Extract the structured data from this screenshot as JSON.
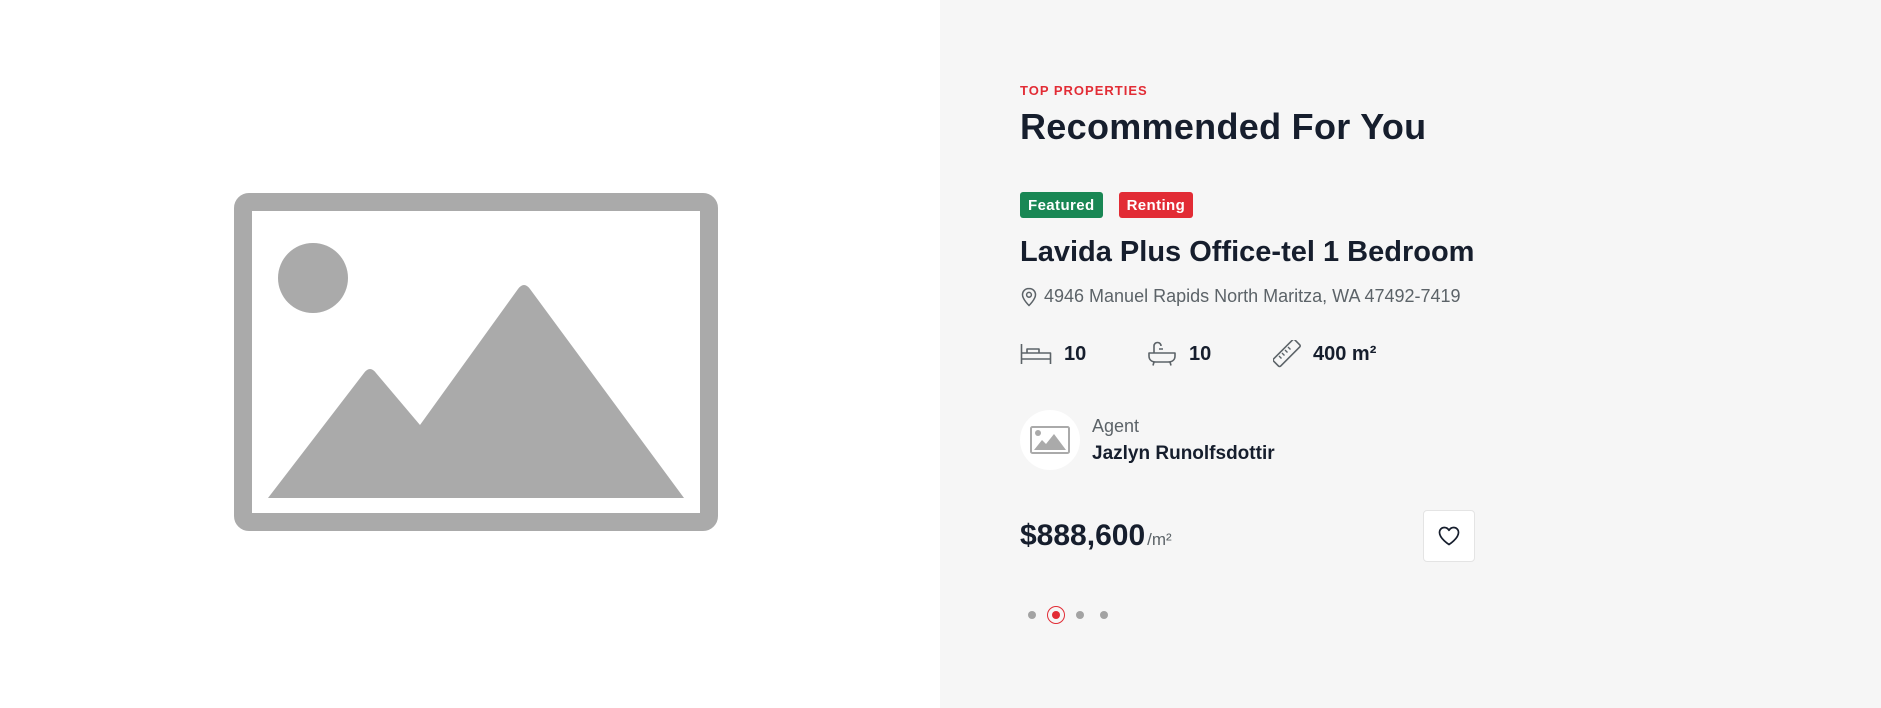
{
  "section": {
    "eyebrow": "TOP PROPERTIES",
    "title": "Recommended For You"
  },
  "property": {
    "image_icon": "image-placeholder-icon",
    "badges": [
      {
        "label": "Featured",
        "color": "#198754"
      },
      {
        "label": "Renting",
        "color": "#e22c35"
      }
    ],
    "title": "Lavida Plus Office-tel 1 Bedroom",
    "address": "4946 Manuel Rapids North Maritza, WA 47492-7419",
    "features": {
      "beds": {
        "icon": "bed-icon",
        "value": "10"
      },
      "baths": {
        "icon": "bathtub-icon",
        "value": "10"
      },
      "area": {
        "icon": "ruler-icon",
        "value": "400 m²"
      }
    },
    "agent": {
      "role": "Agent",
      "name": "Jazlyn Runolfsdottir"
    },
    "price": {
      "value": "$888,600",
      "unit": "/m²"
    },
    "favorite_icon": "heart-icon"
  },
  "carousel": {
    "total": 4,
    "active": 2
  },
  "colors": {
    "accent": "#e22c35",
    "featured": "#198754",
    "text": "#161e2d",
    "muted": "#5c6368",
    "panel_bg": "#f6f6f6"
  }
}
